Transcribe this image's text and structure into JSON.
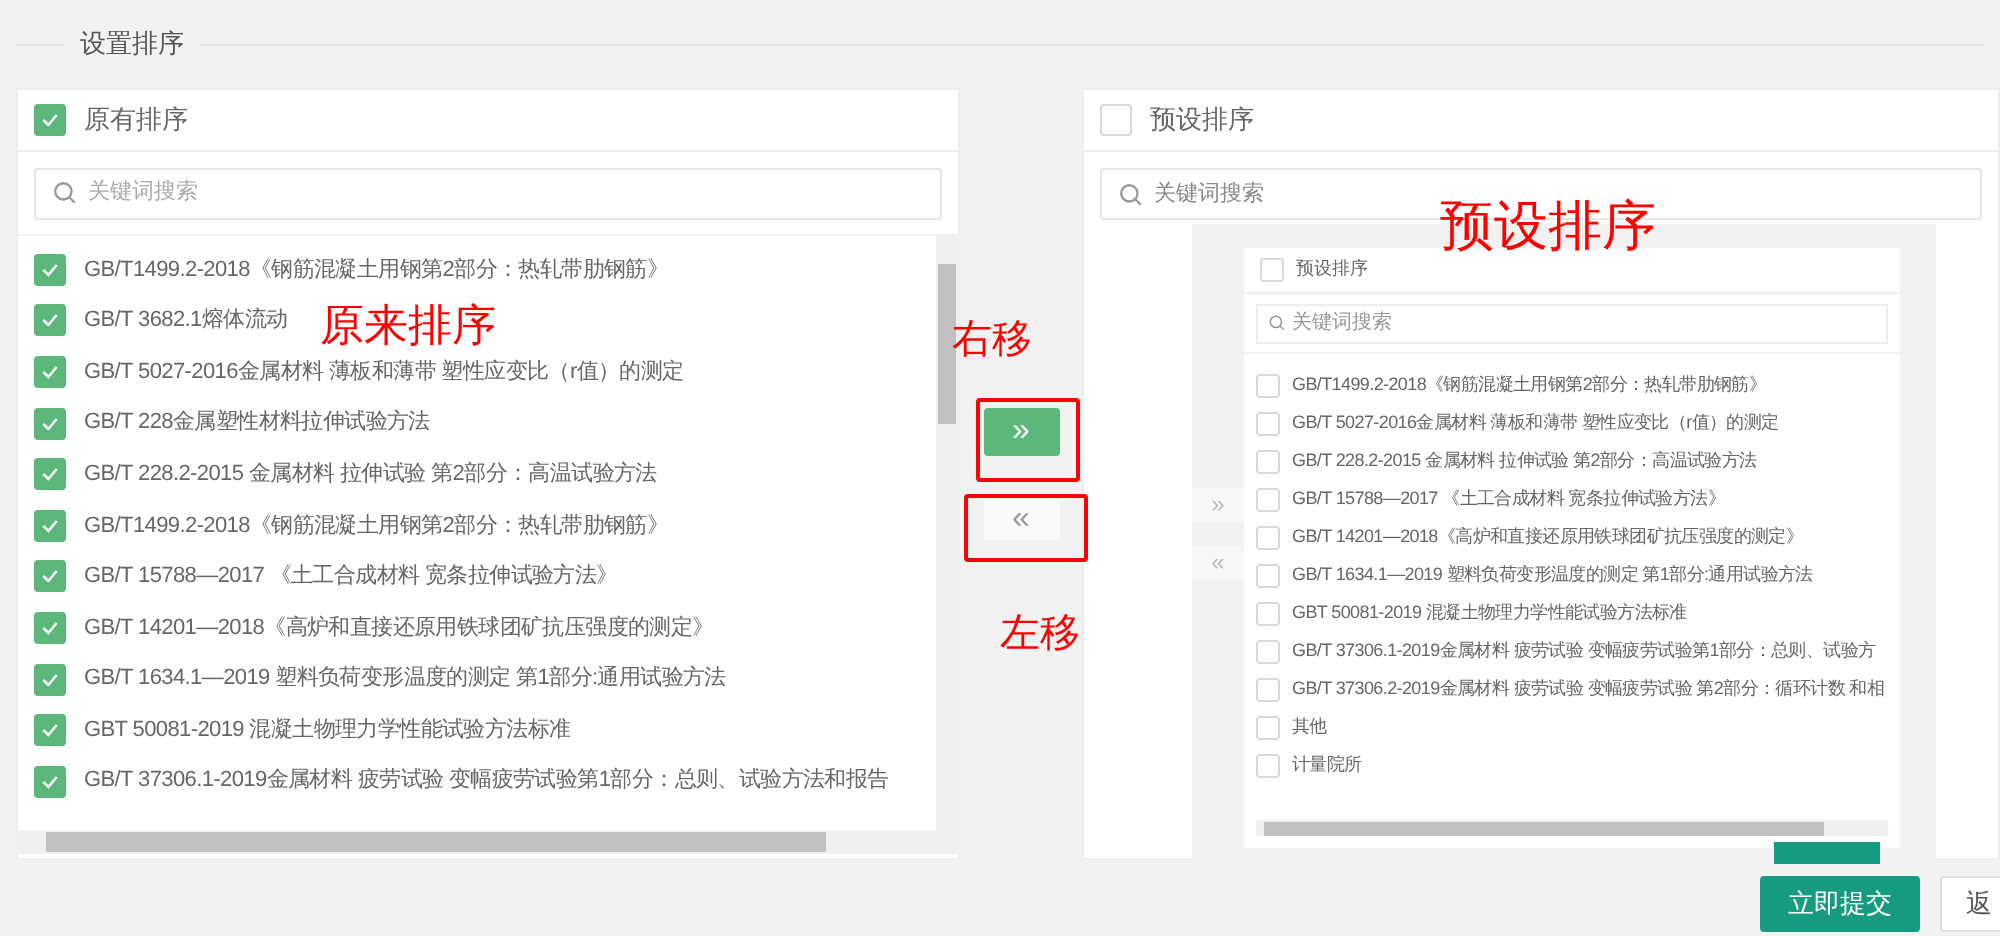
{
  "section_title": "设置排序",
  "source": {
    "title": "原有排序",
    "checked": true,
    "search_placeholder": "关键词搜索",
    "items": [
      {
        "label": "GB/T1499.2-2018《钢筋混凝土用钢第2部分：热轧带肋钢筋》",
        "checked": true
      },
      {
        "label": "GB/T 3682.1熔体流动",
        "checked": true
      },
      {
        "label": "GB/T 5027-2016金属材料 薄板和薄带 塑性应变比（r值）的测定",
        "checked": true
      },
      {
        "label": "GB/T 228金属塑性材料拉伸试验方法",
        "checked": true
      },
      {
        "label": "GB/T 228.2-2015 金属材料 拉伸试验 第2部分：高温试验方法",
        "checked": true
      },
      {
        "label": "GB/T1499.2-2018《钢筋混凝土用钢第2部分：热轧带肋钢筋》",
        "checked": true
      },
      {
        "label": "GB/T 15788—2017 《土工合成材料 宽条拉伸试验方法》",
        "checked": true
      },
      {
        "label": "GB/T 14201—2018《高炉和直接还原用铁球团矿抗压强度的测定》",
        "checked": true
      },
      {
        "label": "GB/T 1634.1—2019 塑料负荷变形温度的测定 第1部分:通用试验方法",
        "checked": true
      },
      {
        "label": "GBT 50081-2019 混凝土物理力学性能试验方法标准",
        "checked": true
      },
      {
        "label": "GB/T 37306.1-2019金属材料 疲劳试验 变幅疲劳试验第1部分：总则、试验方法和报告",
        "checked": true
      }
    ]
  },
  "transfer_buttons": [
    {
      "symbol": "»",
      "disabled": false
    },
    {
      "symbol": "«",
      "disabled": true
    }
  ],
  "target": {
    "title": "预设排序",
    "checked": false,
    "search_placeholder": "关键词搜索"
  },
  "inset_screenshot": {
    "title": "预设排序",
    "checked": false,
    "search_placeholder": "关键词搜索",
    "buttons": [
      {
        "symbol": "»"
      },
      {
        "symbol": "«"
      }
    ],
    "items": [
      {
        "label": "GB/T1499.2-2018《钢筋混凝土用钢第2部分：热轧带肋钢筋》",
        "checked": false
      },
      {
        "label": "GB/T 5027-2016金属材料 薄板和薄带 塑性应变比（r值）的测定",
        "checked": false
      },
      {
        "label": "GB/T 228.2-2015 金属材料 拉伸试验 第2部分：高温试验方法",
        "checked": false
      },
      {
        "label": "GB/T 15788—2017 《土工合成材料 宽条拉伸试验方法》",
        "checked": false
      },
      {
        "label": "GB/T 14201—2018《高炉和直接还原用铁球团矿抗压强度的测定》",
        "checked": false
      },
      {
        "label": "GB/T 1634.1—2019 塑料负荷变形温度的测定 第1部分:通用试验方法",
        "checked": false
      },
      {
        "label": "GBT 50081-2019 混凝土物理力学性能试验方法标准",
        "checked": false
      },
      {
        "label": "GB/T 37306.1-2019金属材料 疲劳试验 变幅疲劳试验第1部分：总则、试验方",
        "checked": false
      },
      {
        "label": "GB/T 37306.2-2019金属材料 疲劳试验 变幅疲劳试验 第2部分：循环计数 和相",
        "checked": false
      },
      {
        "label": "其他",
        "checked": false
      },
      {
        "label": "计量院所",
        "checked": false
      }
    ]
  },
  "annotations": [
    {
      "kind": "source",
      "text": "原来排序"
    },
    {
      "kind": "right",
      "text": "右移"
    },
    {
      "kind": "left",
      "text": "左移"
    },
    {
      "kind": "target",
      "text": "预设排序"
    }
  ],
  "footer_buttons": [
    {
      "label": "立即提交",
      "kind": "primary"
    },
    {
      "label": "返",
      "kind": "secondary"
    }
  ]
}
